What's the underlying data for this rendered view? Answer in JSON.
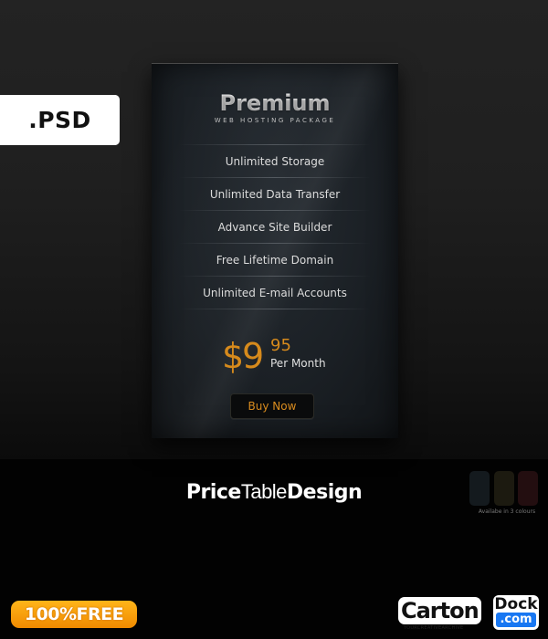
{
  "badge": {
    "label": ".PSD"
  },
  "card": {
    "title": "Premium",
    "subtitle": "WEB HOSTING PACKAGE",
    "features": [
      "Unlimited Storage",
      "Unlimited Data Transfer",
      "Advance Site Builder",
      "Free Lifetime Domain",
      "Unlimited E-mail Accounts"
    ],
    "price": {
      "currency": "$",
      "integer": "9",
      "cents": "95",
      "period": "Per Month"
    },
    "buy_label": "Buy Now",
    "colors": {
      "accent": "#d68a1c",
      "background": "#1b2025"
    }
  },
  "brand": {
    "title_part1": "Price",
    "title_part2": "Table",
    "title_part3": "Design"
  },
  "availability": {
    "caption": "Availabe in 3 colours",
    "swatches": [
      "#141a1e",
      "#1c1a10",
      "#230e10"
    ]
  },
  "free_badge": {
    "label": "100%FREE"
  },
  "logo": {
    "part1": "Carton",
    "part2": "Dock",
    "part3": ".com",
    "tagline": "YOURCREATIVEARCHIVE"
  }
}
